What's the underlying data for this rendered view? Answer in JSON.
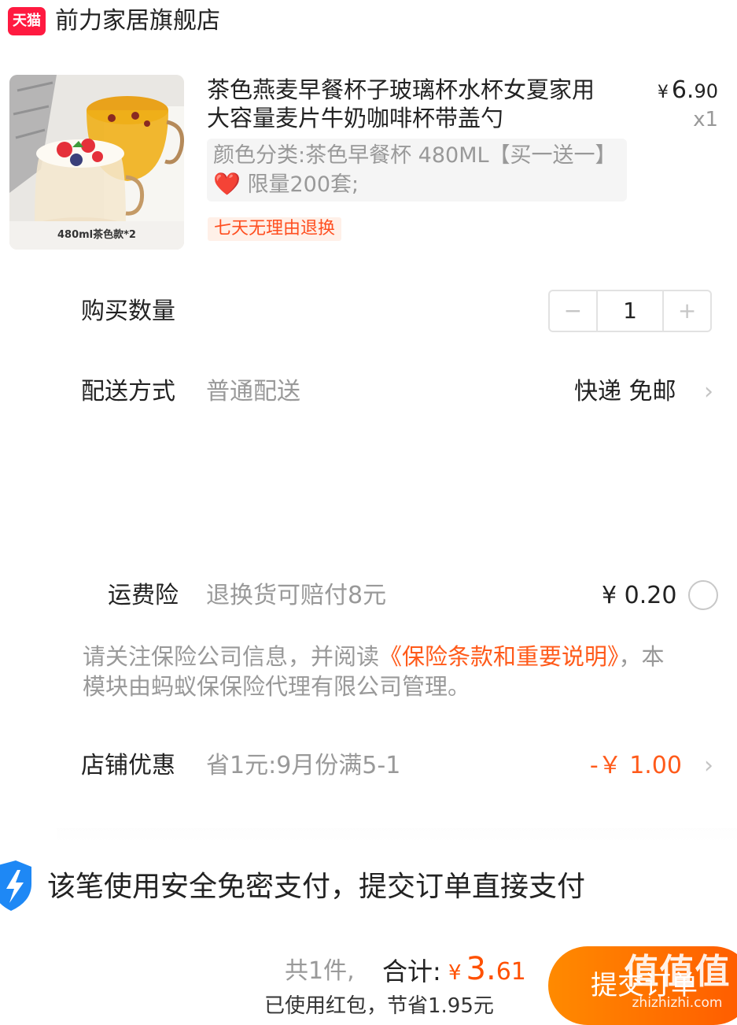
{
  "store": {
    "badge": "天猫",
    "name": "前力家居旗舰店"
  },
  "product": {
    "title": "茶色燕麦早餐杯子玻璃杯水杯女夏家用大容量麦片牛奶咖啡杯带盖勺",
    "price_symbol": "¥",
    "price_int": "6.",
    "price_cents": "90",
    "quantity": "x1",
    "sku_prefix": "颜色分类:茶色早餐杯 480ML【买一送一】",
    "sku_suffix": " 限量200套;",
    "return_policy": "七天无理由退换",
    "image_caption": "480ml茶色款*2"
  },
  "quantity_row": {
    "label": "购买数量",
    "minus": "−",
    "value": "1",
    "plus": "+"
  },
  "delivery_row": {
    "label": "配送方式",
    "method": "普通配送",
    "value": "快递 免邮"
  },
  "insurance_row": {
    "label": "运费险",
    "desc": "退换货可赔付8元",
    "price": "¥ 0.20"
  },
  "notice": {
    "prefix": "请关注保险公司信息，并阅读",
    "link": "《保险条款和重要说明》",
    "suffix": "，本模块由蚂蚁保保险代理有限公司管理。"
  },
  "discount_row": {
    "label": "店铺优惠",
    "desc": "省1元:9月份满5-1",
    "value": "-￥ 1.00"
  },
  "payment_banner": {
    "text": "该笔使用安全免密支付，提交订单直接支付"
  },
  "footer": {
    "count": "共1件,",
    "total_label": "合计:",
    "total_symbol": "¥",
    "total_int": "3.",
    "total_cents": "61",
    "note": "已使用红包，节省1.95元",
    "submit": "提交订单"
  },
  "watermark": {
    "big": "值值值",
    "small": "zhizhizhi.com"
  },
  "colors": {
    "accent": "#ff5000",
    "tmall_red": "#ff1a40",
    "muted": "#999999"
  }
}
